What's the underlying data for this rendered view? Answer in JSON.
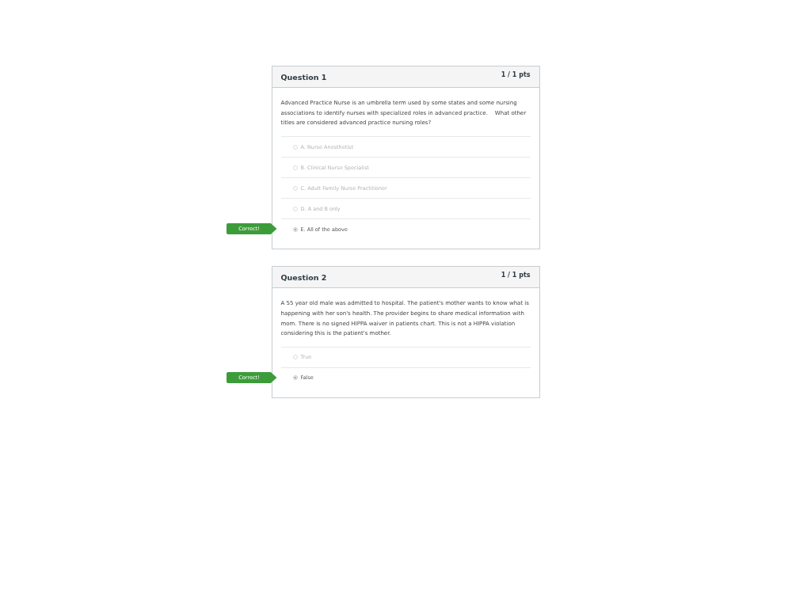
{
  "questions": [
    {
      "title": "Question 1",
      "points": "1 / 1 pts",
      "text": "Advanced Practice Nurse is an umbrella term used by some states and some nursing associations to identify nurses with specialized roles in advanced practice.    What other titles are considered advanced practice nursing roles?",
      "answers": [
        {
          "label": "A. Nurse Anesthetist",
          "selected": false
        },
        {
          "label": "B. Clinical Nurse Specialist",
          "selected": false
        },
        {
          "label": "C. Adult Family Nurse Practitioner",
          "selected": false
        },
        {
          "label": "D. A and B only",
          "selected": false
        },
        {
          "label": "E. All of the above",
          "selected": true,
          "flag": "Correct!"
        }
      ]
    },
    {
      "title": "Question 2",
      "points": "1 / 1 pts",
      "text": "A 55 year old male was admitted to hospital. The patient's mother wants to know what is happening with her son's health. The provider begins to share medical information with mom. There is no signed HIPPA waiver in patients chart. This is not a HIPPA violation considering this is the patient's mother.",
      "answers": [
        {
          "label": "True",
          "selected": false
        },
        {
          "label": "False",
          "selected": true,
          "flag": "Correct!"
        }
      ]
    }
  ]
}
